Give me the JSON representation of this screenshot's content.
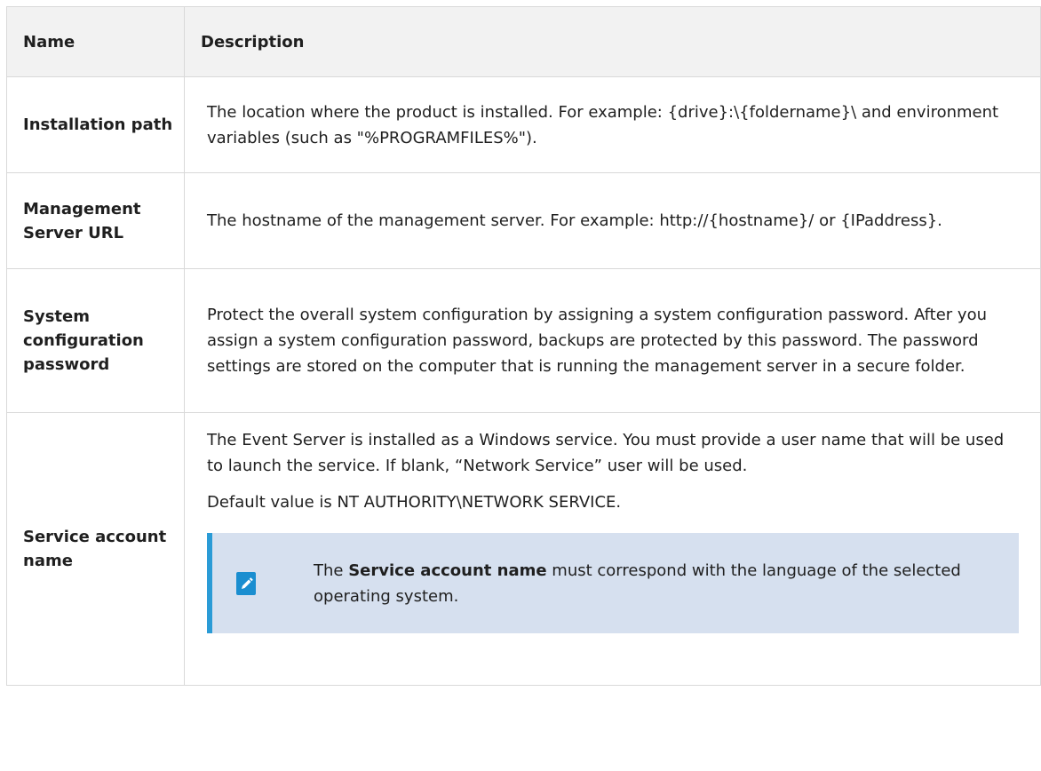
{
  "table": {
    "headers": {
      "name": "Name",
      "description": "Description"
    },
    "rows": [
      {
        "name": "Installation path",
        "description": "The location where the product is installed. For example: {drive}:\\{foldername}\\ and environment variables (such as \"%PROGRAMFILES%\")."
      },
      {
        "name": "Management Server URL",
        "description": "The hostname of the management server. For example: http://{hostname}/ or {IPaddress}."
      },
      {
        "name": "System configuration password",
        "description": "Protect the overall system configuration by assigning a system configuration password. After you assign a system configuration password, backups are protected by this password. The password settings are stored on the computer that is running the management server in a secure folder."
      },
      {
        "name": "Service account name",
        "description": "The Event Server is installed as a Windows service. You must provide a user name that will be used to launch the service. If blank, “Network Service” user will be used.",
        "description_2": "Default value is NT AUTHORITY\\NETWORK SERVICE.",
        "note": {
          "icon": "pencil-icon",
          "text_before": "The ",
          "text_bold": "Service account name",
          "text_after": " must correspond with the language of the selected operating system."
        }
      }
    ]
  },
  "colors": {
    "header_bg": "#f2f2f2",
    "border": "#d9d9d9",
    "note_bg": "#d6e0ef",
    "note_accent": "#2a9bd6",
    "icon_color": "#1a8ed0"
  }
}
